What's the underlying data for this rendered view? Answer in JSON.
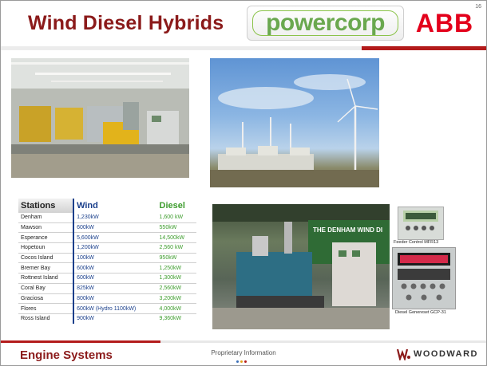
{
  "slide": {
    "title": "Wind Diesel Hybrids",
    "page_number": "16",
    "logos": {
      "powercorp": "powercorp",
      "abb": "ABB"
    }
  },
  "table": {
    "headers": {
      "stations": "Stations",
      "wind": "Wind",
      "diesel": "Diesel"
    },
    "rows": [
      {
        "station": "Denham",
        "wind": "1,230kW",
        "diesel": "1,600 kW"
      },
      {
        "station": "Mawson",
        "wind": "600kW",
        "diesel": "550kW"
      },
      {
        "station": "Esperance",
        "wind": "5,600kW",
        "diesel": "14,500kW"
      },
      {
        "station": "Hopetoun",
        "wind": "1,200kW",
        "diesel": "2,560 kW"
      },
      {
        "station": "Cocos Island",
        "wind": "100kW",
        "diesel": "950kW"
      },
      {
        "station": "Bremer Bay",
        "wind": "600kW",
        "diesel": "1,250kW"
      },
      {
        "station": "Rottnest Island",
        "wind": "600kW",
        "diesel": "1,300kW"
      },
      {
        "station": "Coral Bay",
        "wind": "825kW",
        "diesel": "2,560kW"
      },
      {
        "station": "Graciosa",
        "wind": "800kW",
        "diesel": "3,200kW"
      },
      {
        "station": "Flores",
        "wind": "600kW (Hydro 1100kW)",
        "diesel": "4,000kW"
      },
      {
        "station": "Ross Island",
        "wind": "900kW",
        "diesel": "9,360kW"
      }
    ]
  },
  "captions": {
    "feeder": "Feeder  Control  MFR13",
    "genset": "Diesel Genereset  GCP-31",
    "panel_sign": "THE DENHAM WIND DI"
  },
  "footer": {
    "left": "Engine Systems",
    "center": "Proprietary Information",
    "right": "WOODWARD"
  },
  "colors": {
    "title_red": "#8b1a1a",
    "wind_blue": "#1a3f8b",
    "diesel_green": "#3c9c2c",
    "abb_red": "#e3001b",
    "powercorp_green": "#6aa84f"
  },
  "icons": [
    "woodward-logo-icon",
    "slide-nav-dots-icon"
  ]
}
